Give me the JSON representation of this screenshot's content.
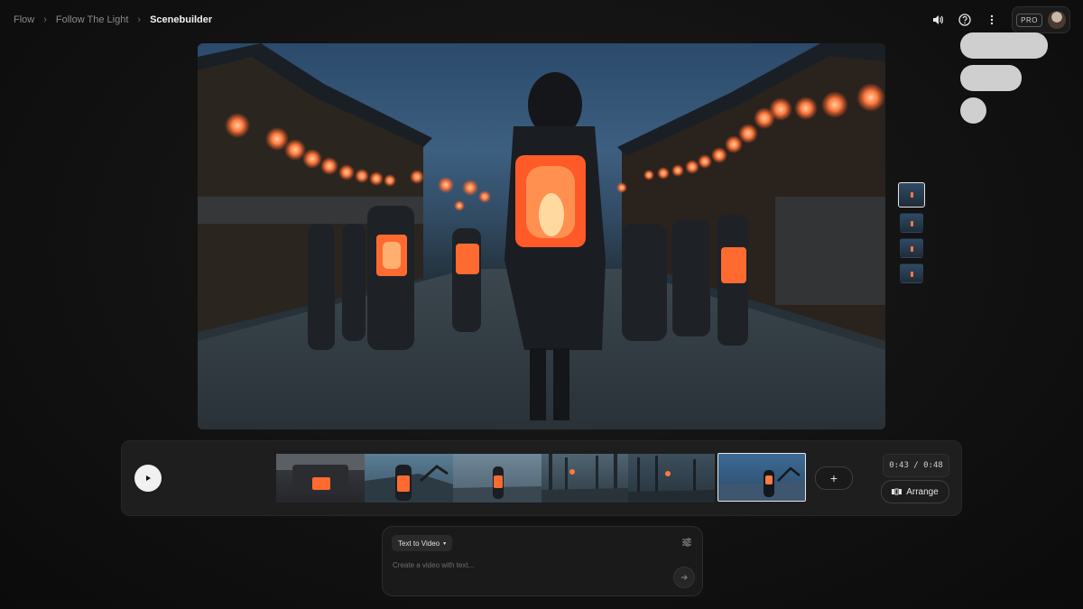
{
  "breadcrumb": {
    "items": [
      "Flow",
      "Follow The Light",
      "Scenebuilder"
    ]
  },
  "header": {
    "pro_label": "PRO",
    "icons": [
      "volume-icon",
      "help-icon",
      "more-vert-icon"
    ]
  },
  "timeline": {
    "time_readout": "0:43 / 0:48",
    "arrange_label": "Arrange",
    "add_label": "+"
  },
  "composer": {
    "mode_label": "Text to Video",
    "placeholder": "Create a video with text..."
  },
  "colors": {
    "background": "#101010",
    "panel": "#1e1e1e",
    "accent_lantern": "#ff7a40"
  }
}
